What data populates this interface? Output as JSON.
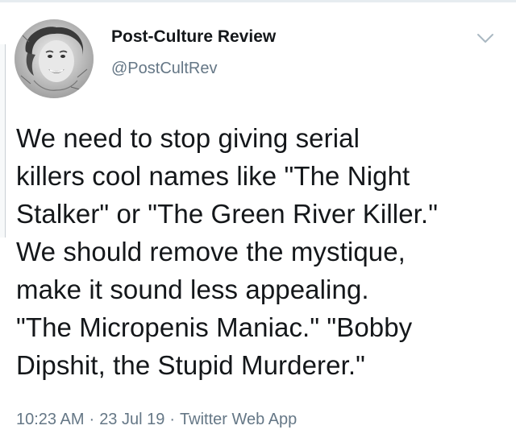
{
  "tweet": {
    "display_name": "Post-Culture Review",
    "handle": "@PostCultRev",
    "text": "We need to stop giving serial\nkillers cool names like \"The Night\nStalker\" or \"The Green River Killer.\"\nWe should remove the mystique,\nmake it sound less appealing.\n\"The Micropenis Maniac.\" \"Bobby\nDipshit, the Stupid Murderer.\"",
    "time": "10:23 AM",
    "date": "23 Jul 19",
    "source": "Twitter Web App",
    "separator": "·"
  },
  "icons": {
    "menu": "chevron-down-icon",
    "avatar": "avatar"
  },
  "colors": {
    "text": "#14171a",
    "secondary": "#657786",
    "divider": "#e6ecf0"
  }
}
